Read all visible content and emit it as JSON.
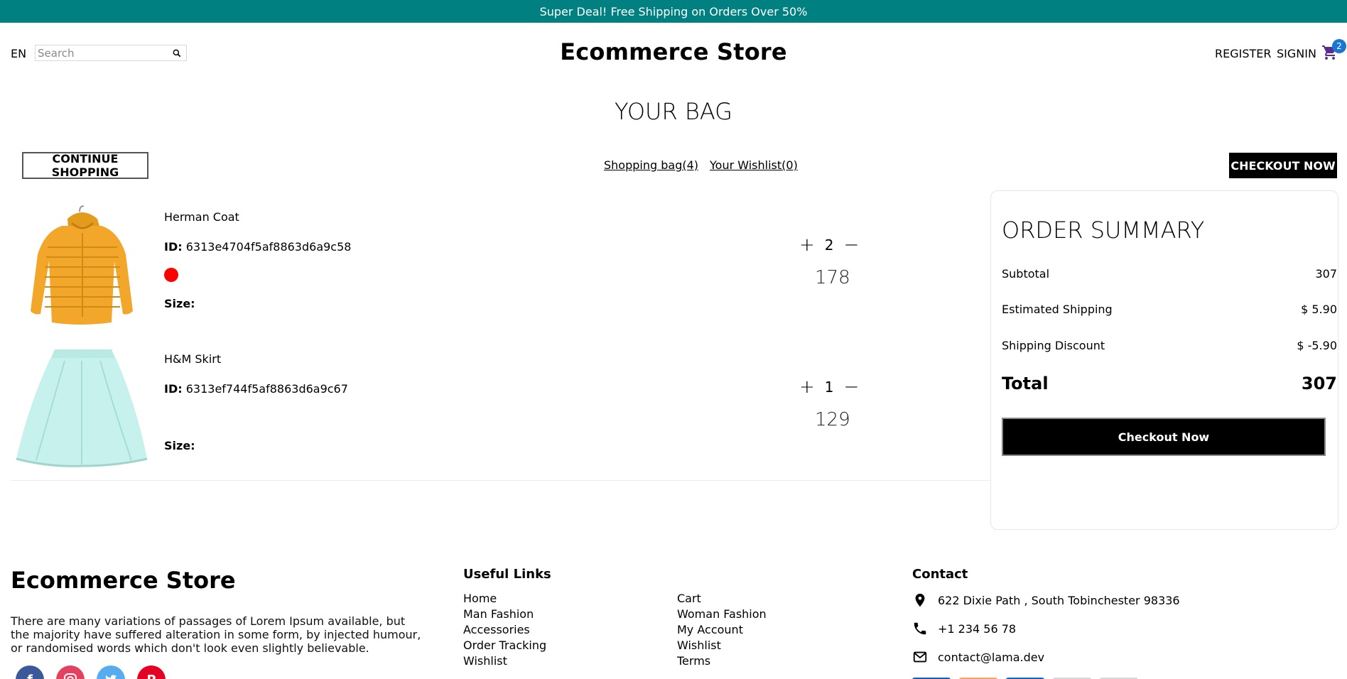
{
  "announcement": "Super Deal! Free Shipping on Orders Over 50%",
  "nav": {
    "lang": "EN",
    "search_placeholder": "Search",
    "logo": "Ecommerce Store",
    "register": "REGISTER",
    "signin": "SIGNIN",
    "cart_count": "2"
  },
  "bag": {
    "title": "YOUR BAG",
    "continue_label": "CONTINUE SHOPPING",
    "shopping_bag": "Shopping bag(4)",
    "wishlist": "Your Wishlist(0)",
    "checkout_label": "CHECKOUT NOW"
  },
  "products": [
    {
      "name": "Herman Coat",
      "id_label": "ID:",
      "id": "6313e4704f5af8863d6a9c58",
      "color": "#ff0000",
      "size_label": "Size:",
      "quantity": "2",
      "price": "178"
    },
    {
      "name": "H&M Skirt",
      "id_label": "ID:",
      "id": "6313ef744f5af8863d6a9c67",
      "color": "",
      "size_label": "Size:",
      "quantity": "1",
      "price": "129"
    }
  ],
  "summary": {
    "title": "ORDER SUMMARY",
    "subtotal_label": "Subtotal",
    "subtotal": "307",
    "shipping_label": "Estimated Shipping",
    "shipping": "$ 5.90",
    "discount_label": "Shipping Discount",
    "discount": "$ -5.90",
    "total_label": "Total",
    "total": "307",
    "button": "Checkout Now"
  },
  "footer": {
    "logo": "Ecommerce Store",
    "description": "There are many variations of passages of Lorem Ipsum available, but the majority have suffered alteration in some form, by injected humour, or randomised words which don't look even slightly believable.",
    "links_title": "Useful Links",
    "links": [
      "Home",
      "Cart",
      "Man Fashion",
      "Woman Fashion",
      "Accessories",
      "My Account",
      "Order Tracking",
      "Wishlist",
      "Wishlist",
      "Terms"
    ],
    "contact_title": "Contact",
    "address": "622 Dixie Path , South Tobinchester 98336",
    "phone": "+1 234 56 78",
    "email": "contact@lama.dev"
  },
  "colors": {
    "announcement_bg": "#008080",
    "facebook": "#3B5999",
    "instagram": "#E4405F",
    "twitter": "#55ACEE",
    "pinterest": "#E60023"
  }
}
